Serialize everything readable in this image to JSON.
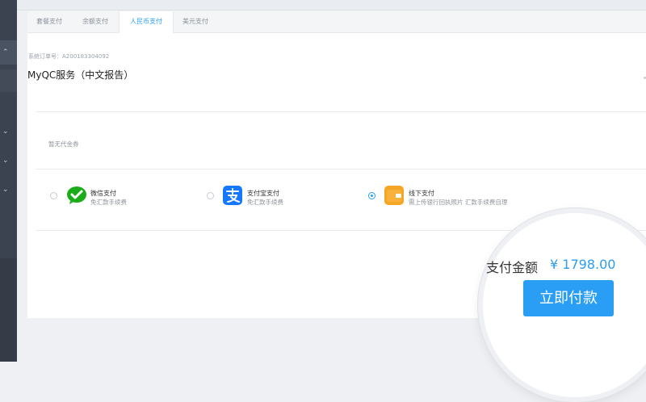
{
  "tabs": [
    {
      "label": "套餐支付"
    },
    {
      "label": "余额支付"
    },
    {
      "label": "人民币支付",
      "active": true
    },
    {
      "label": "美元支付"
    }
  ],
  "order": {
    "order_no": "系统订单号：A200183304092",
    "product": "MyQC服务（中文报告）"
  },
  "coupon_text": "暂无代金券",
  "payment_methods": [
    {
      "name": "微信支付",
      "desc": "免汇款手续费",
      "selected": false,
      "icon": "wechat-icon"
    },
    {
      "name": "支付宝支付",
      "desc": "免汇款手续费",
      "selected": false,
      "icon": "alipay-icon"
    },
    {
      "name": "线下支付",
      "desc": "需上传银行回执照片 汇款手续费自理",
      "selected": true,
      "icon": "wallet-icon"
    }
  ],
  "summary": {
    "amount_label": "支付金额",
    "amount_value": "¥ 1798.00",
    "pay_button": "立即付款"
  },
  "colors": {
    "accent": "#2a9df4",
    "wechat": "#1aad19",
    "alipay": "#1677ff",
    "wallet": "#f5a623"
  }
}
